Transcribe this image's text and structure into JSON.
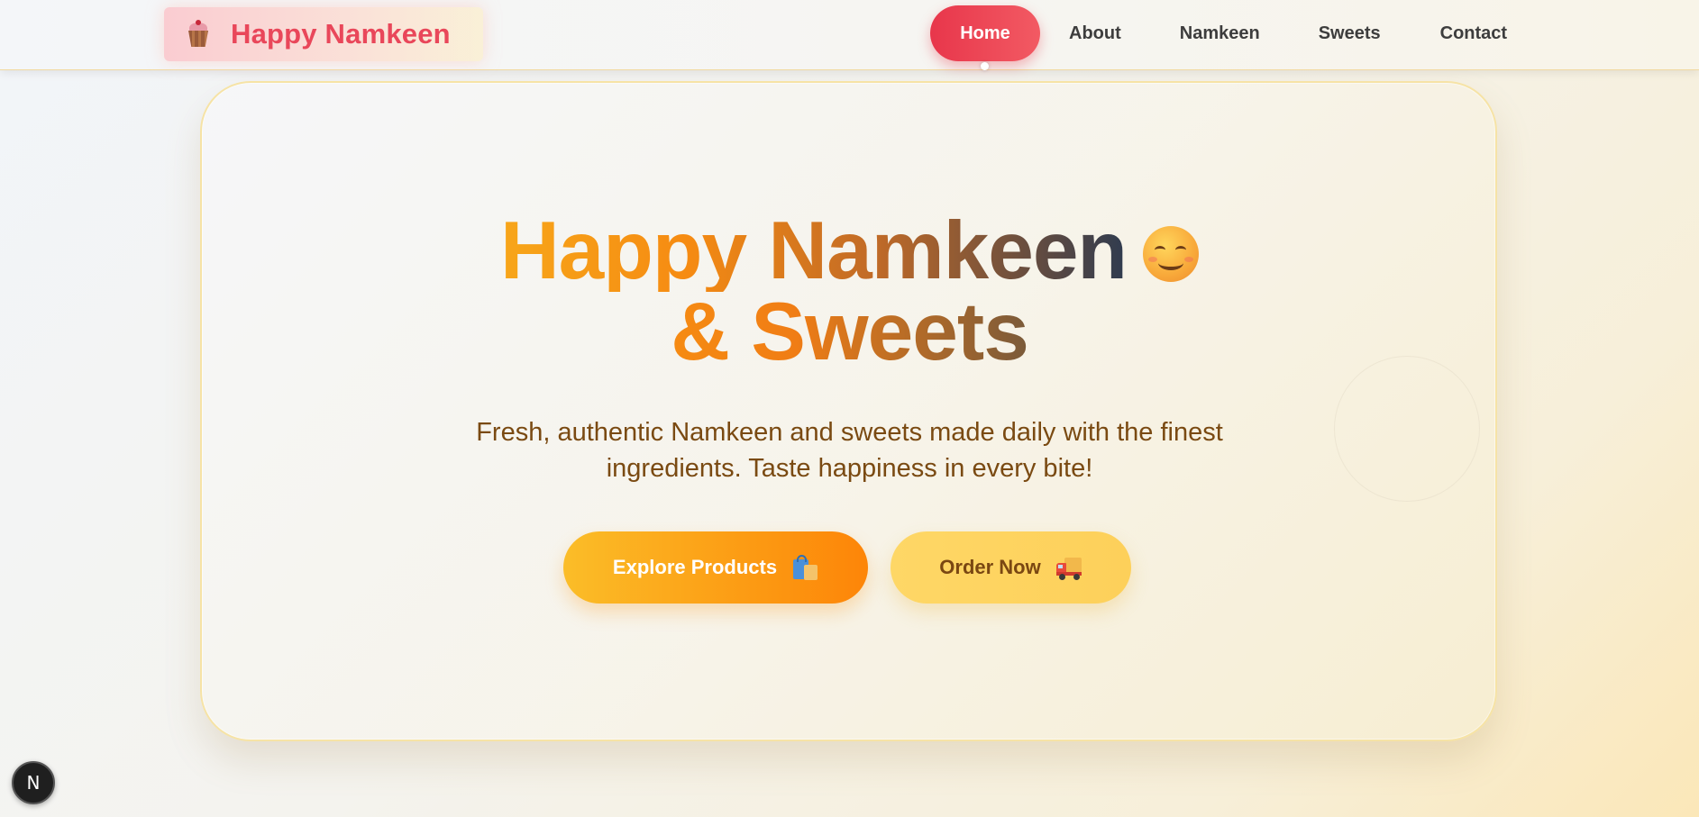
{
  "navbar": {
    "brand": {
      "icon": "cupcake-icon",
      "name": "Happy Namkeen"
    },
    "links": [
      {
        "label": "Home",
        "active": true
      },
      {
        "label": "About",
        "active": false
      },
      {
        "label": "Namkeen",
        "active": false
      },
      {
        "label": "Sweets",
        "active": false
      },
      {
        "label": "Contact",
        "active": false
      }
    ]
  },
  "hero": {
    "title_line1": "Happy Namkeen",
    "title_emoji": "smiling-face-icon",
    "title_line2": "& Sweets",
    "subtitle_line1": "Fresh, authentic Namkeen and sweets made daily with the finest",
    "subtitle_line2": "ingredients. Taste happiness in every bite!",
    "buttons": {
      "explore": {
        "label": "Explore Products",
        "icon": "shopping-bags-icon"
      },
      "order": {
        "label": "Order Now",
        "icon": "delivery-truck-icon"
      }
    }
  },
  "dev_badge": {
    "label": "N",
    "icon": "nextjs-icon"
  },
  "colors": {
    "brand_red": "#e9475a",
    "active_nav": "#e8364b",
    "accent_orange": "#fd8508",
    "accent_yellow": "#fed766",
    "subtitle_brown": "#7a4a12"
  }
}
